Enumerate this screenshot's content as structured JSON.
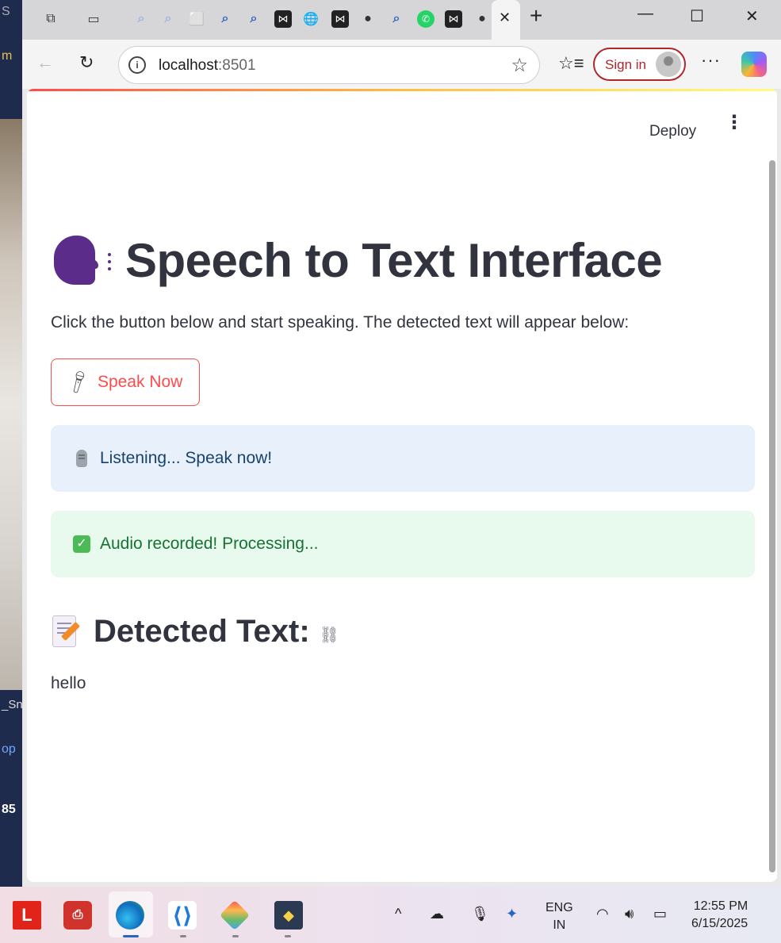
{
  "background_window": {
    "fragments": [
      "S",
      "m",
      "_Sn",
      "op",
      "85"
    ]
  },
  "browser": {
    "tabs": {
      "icons": [
        "tab-actions-icon",
        "workspaces-icon",
        "search-icon",
        "search-icon",
        "cube-icon",
        "search-icon",
        "search-icon",
        "site-icon",
        "globe-icon",
        "site-icon",
        "github-icon",
        "search-icon",
        "whatsapp-icon",
        "site-icon",
        "github-icon"
      ],
      "close_glyph": "✕",
      "new_tab_glyph": "+"
    },
    "window_controls": {
      "minimize": "—",
      "maximize": "☐",
      "close": "✕"
    },
    "toolbar": {
      "url_host": "localhost",
      "url_port": ":8501",
      "signin_label": "Sign in",
      "more_label": "···"
    }
  },
  "app": {
    "deploy_label": "Deploy",
    "menu_glyph": "⋮",
    "title": "Speech to Text Interface",
    "description": "Click the button below and start speaking. The detected text will appear below:",
    "speak_button_label": "Speak Now",
    "info_message": "Listening... Speak now!",
    "success_message": "Audio recorded! Processing...",
    "detected_heading": "Detected Text:",
    "detected_text": "hello",
    "accent_color": "#ff4b4b",
    "info_color": "#17426d",
    "success_color": "#177233"
  },
  "taskbar": {
    "apps": [
      "lenovo-icon",
      "pdf-app-icon",
      "edge-icon",
      "vscode-icon",
      "git-app-icon",
      "python-icon"
    ],
    "language_line1": "ENG",
    "language_line2": "IN",
    "time": "12:55 PM",
    "date": "6/15/2025"
  }
}
